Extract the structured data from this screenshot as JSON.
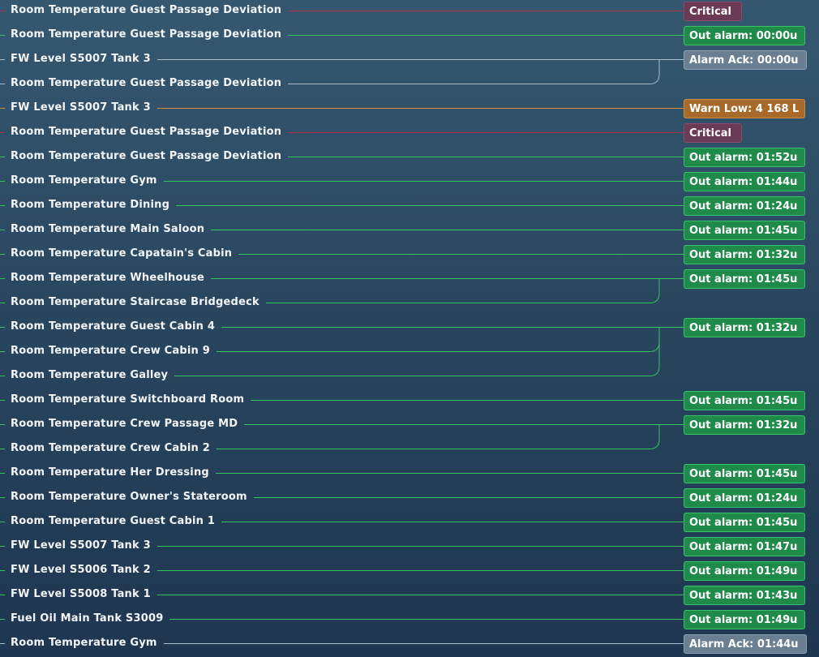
{
  "colors": {
    "critical_line": "#b0324a",
    "out_line": "#33c45c",
    "ack_line": "#a9bccb",
    "warn_line": "#d68a3a"
  },
  "rows": [
    {
      "label": "Room Temperature Guest Passage Deviation",
      "status": "critical",
      "badge": "Critical"
    },
    {
      "label": "Room Temperature Guest Passage Deviation",
      "status": "out",
      "badge": "Out alarm: 00:00u"
    },
    {
      "label": "FW Level S5007 Tank 3",
      "status": "ack",
      "badge": "Alarm Ack: 00:00u"
    },
    {
      "label": "Room Temperature Guest Passage Deviation",
      "status": "ack",
      "badge": ""
    },
    {
      "label": "FW Level S5007 Tank 3",
      "status": "warn",
      "badge": "Warn Low: 4 168 L"
    },
    {
      "label": "Room Temperature Guest Passage Deviation",
      "status": "critical",
      "badge": "Critical"
    },
    {
      "label": "Room Temperature Guest Passage Deviation",
      "status": "out",
      "badge": "Out alarm: 01:52u"
    },
    {
      "label": "Room Temperature Gym",
      "status": "out",
      "badge": "Out alarm: 01:44u"
    },
    {
      "label": "Room Temperature Dining",
      "status": "out",
      "badge": "Out alarm: 01:24u"
    },
    {
      "label": "Room Temperature Main Saloon",
      "status": "out",
      "badge": "Out alarm: 01:45u"
    },
    {
      "label": "Room Temperature Capatain's Cabin",
      "status": "out",
      "badge": "Out alarm: 01:32u"
    },
    {
      "label": "Room Temperature Wheelhouse",
      "status": "out",
      "badge": "Out alarm: 01:45u"
    },
    {
      "label": "Room Temperature Staircase Bridgedeck",
      "status": "out",
      "badge": ""
    },
    {
      "label": "Room Temperature Guest Cabin 4",
      "status": "out",
      "badge": "Out alarm: 01:32u"
    },
    {
      "label": "Room Temperature Crew Cabin 9",
      "status": "out",
      "badge": ""
    },
    {
      "label": "Room Temperature Galley",
      "status": "out",
      "badge": ""
    },
    {
      "label": "Room Temperature Switchboard Room",
      "status": "out",
      "badge": "Out alarm: 01:45u"
    },
    {
      "label": "Room Temperature Crew Passage MD",
      "status": "out",
      "badge": "Out alarm: 01:32u"
    },
    {
      "label": "Room Temperature Crew Cabin 2",
      "status": "out",
      "badge": ""
    },
    {
      "label": "Room Temperature Her Dressing",
      "status": "out",
      "badge": "Out alarm: 01:45u"
    },
    {
      "label": "Room Temperature Owner's Stateroom",
      "status": "out",
      "badge": "Out alarm: 01:24u"
    },
    {
      "label": "Room Temperature Guest Cabin 1",
      "status": "out",
      "badge": "Out alarm: 01:45u"
    },
    {
      "label": "FW Level S5007 Tank 3",
      "status": "out",
      "badge": "Out alarm: 01:47u"
    },
    {
      "label": "FW Level S5006 Tank 2",
      "status": "out",
      "badge": "Out alarm: 01:49u"
    },
    {
      "label": "FW Level S5008 Tank 1",
      "status": "out",
      "badge": "Out alarm: 01:43u"
    },
    {
      "label": "Fuel Oil Main Tank S3009",
      "status": "out",
      "badge": "Out alarm: 01:49u"
    },
    {
      "label": "Room Temperature Gym",
      "status": "ack",
      "badge": "Alarm Ack: 01:44u"
    }
  ],
  "groups": [
    {
      "from": 2,
      "to": [
        3
      ]
    },
    {
      "from": 11,
      "to": [
        12
      ]
    },
    {
      "from": 13,
      "to": [
        14,
        15
      ]
    },
    {
      "from": 17,
      "to": [
        18
      ]
    }
  ]
}
